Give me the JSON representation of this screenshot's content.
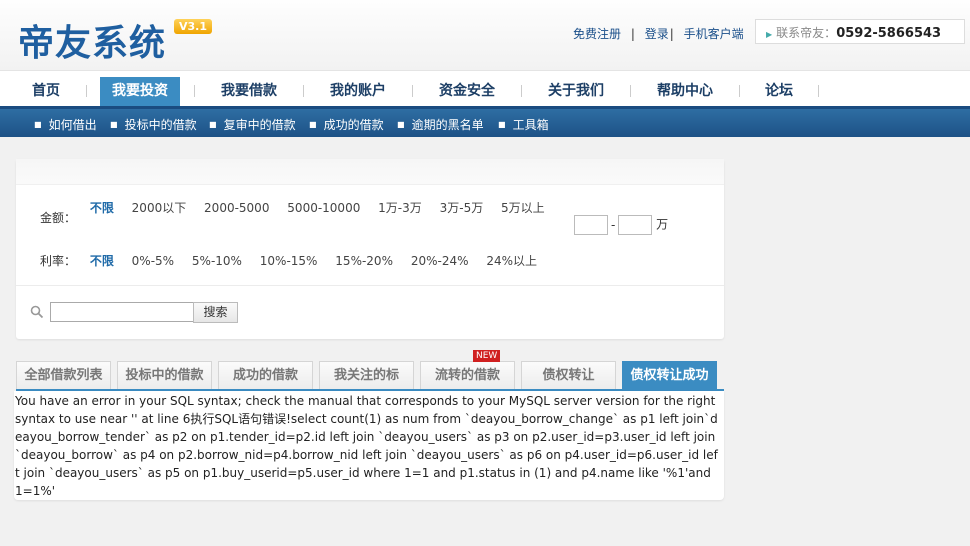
{
  "header": {
    "logo_text": "帝友系统",
    "version": "V3.1",
    "links": [
      "免费注册",
      "登录",
      "手机客户端"
    ],
    "separators": [
      "|",
      "|"
    ],
    "contact_label": "联系帝友",
    "contact_colon": "：",
    "contact_phone": "0592-5866543"
  },
  "nav": {
    "items": [
      {
        "label": "首页"
      },
      {
        "label": "我要投资"
      },
      {
        "label": "我要借款"
      },
      {
        "label": "我的账户"
      },
      {
        "label": "资金安全"
      },
      {
        "label": "关于我们"
      },
      {
        "label": "帮助中心"
      },
      {
        "label": "论坛"
      }
    ],
    "active": "我要投资"
  },
  "subnav": {
    "items": [
      "如何借出",
      "投标中的借款",
      "复审中的借款",
      "成功的借款",
      "逾期的黑名单",
      "工具箱"
    ]
  },
  "filter": {
    "amount": {
      "label": "金额：",
      "options": [
        "不限",
        "2000以下",
        "2000-5000",
        "5000-10000",
        "1万-3万",
        "3万-5万",
        "5万以上"
      ],
      "selected": "不限"
    },
    "rate": {
      "label": "利率：",
      "options": [
        "不限",
        "0%-5%",
        "5%-10%",
        "10%-15%",
        "15%-20%",
        "20%-24%",
        "24%以上"
      ],
      "selected": "不限"
    },
    "range": {
      "dash": "-",
      "unit": "万"
    },
    "search": {
      "value": "",
      "button_label": "搜索"
    }
  },
  "tabs": {
    "items": [
      "全部借款列表",
      "投标中的借款",
      "成功的借款",
      "我关注的标",
      "流转的借款",
      "债权转让",
      "债权转让成功"
    ],
    "active": "债权转让成功",
    "new_badge": "NEW"
  },
  "error": {
    "message": "You have an error in your SQL syntax; check the manual that corresponds to your MySQL server version for the right syntax to use near '' at line 6执行SQL语句错误!select count(1) as num from `deayou_borrow_change` as p1 left join`deayou_borrow_tender` as p2 on p1.tender_id=p2.id left join `deayou_users` as p3 on p2.user_id=p3.user_id left join `deayou_borrow` as p4 on p2.borrow_nid=p4.borrow_nid left join `deayou_users` as p6 on p4.user_id=p6.user_id left join `deayou_users` as p5 on p1.buy_userid=p5.user_id where 1=1 and p1.status in (1) and p4.name like '%1'and 1=1%'"
  },
  "colors": {
    "accent": "#3b8cc2",
    "subnav_bg": "#1d5286",
    "selected_option": "#1f6aa8",
    "new_badge": "#d02020"
  }
}
